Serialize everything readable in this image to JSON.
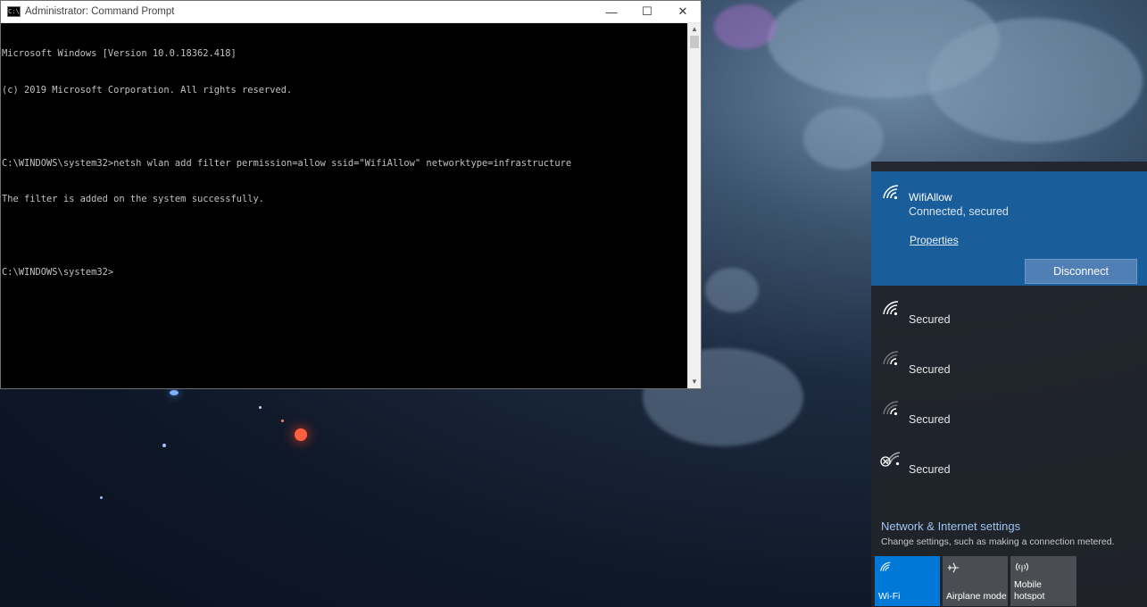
{
  "cmd": {
    "title": "Administrator: Command Prompt",
    "icon_label": "C:\\",
    "minimize_label": "—",
    "maximize_label": "☐",
    "close_label": "✕",
    "lines": [
      "Microsoft Windows [Version 10.0.18362.418]",
      "(c) 2019 Microsoft Corporation. All rights reserved.",
      "",
      "C:\\WINDOWS\\system32>netsh wlan add filter permission=allow ssid=\"WifiAllow\" networktype=infrastructure",
      "The filter is added on the system successfully.",
      "",
      "C:\\WINDOWS\\system32>"
    ]
  },
  "network": {
    "connected": {
      "name": "WifiAllow",
      "status": "Connected, secured",
      "properties_label": "Properties",
      "disconnect_label": "Disconnect"
    },
    "others": [
      {
        "status": "Secured",
        "icon": "wifi-strong-icon"
      },
      {
        "status": "Secured",
        "icon": "wifi-weak-icon"
      },
      {
        "status": "Secured",
        "icon": "wifi-weak-icon"
      },
      {
        "status": "Secured",
        "icon": "wifi-unavailable-icon"
      }
    ],
    "settings_title": "Network & Internet settings",
    "settings_subtitle": "Change settings, such as making a connection metered.",
    "quick_actions": [
      {
        "label": "Wi-Fi",
        "active": true,
        "icon": "wifi-icon"
      },
      {
        "label": "Airplane mode",
        "active": false,
        "icon": "airplane-icon"
      },
      {
        "label": "Mobile hotspot",
        "active": false,
        "icon": "hotspot-icon"
      }
    ]
  },
  "colors": {
    "accent": "#0078d7",
    "connected_panel": "#1a5d9b",
    "flyout_bg": "#20242a",
    "tile_inactive": "#4a4d52"
  }
}
